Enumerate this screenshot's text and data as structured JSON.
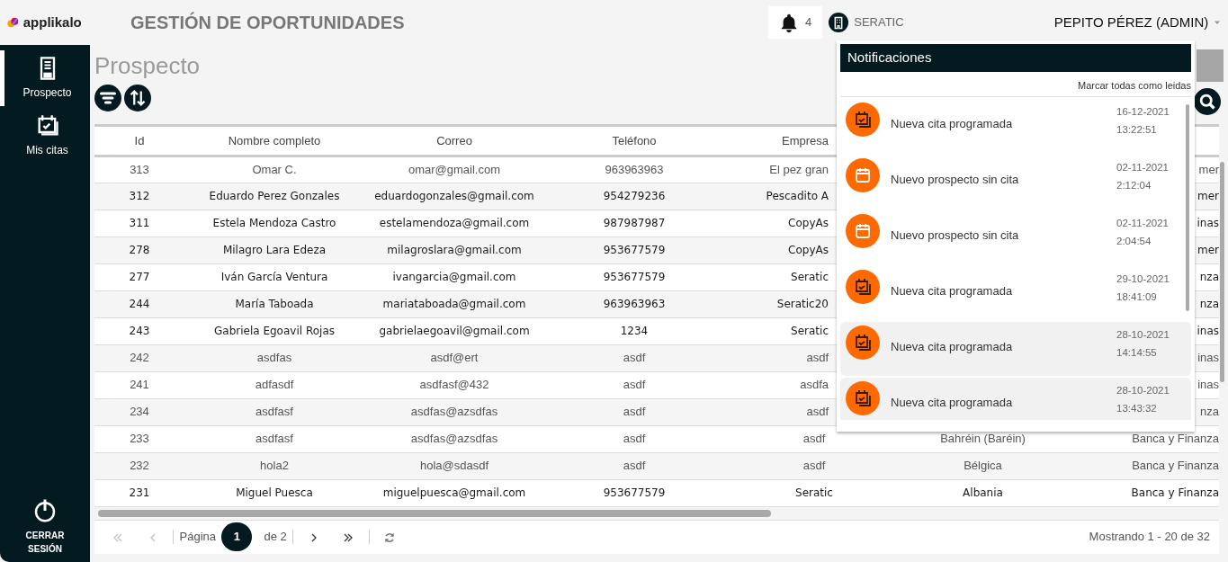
{
  "header": {
    "logo_text": "applikalo",
    "title": "GESTIÓN DE OPORTUNIDADES",
    "notification_count": "4",
    "company": "SERATIC",
    "user": "PEPITO PÉREZ (ADMIN)"
  },
  "sidebar": {
    "items": [
      {
        "kind": "document",
        "label": "Prospecto",
        "selected": true
      },
      {
        "kind": "calendar",
        "label": "Mis citas",
        "selected": false
      }
    ],
    "logout": "CERRAR SESIÓN"
  },
  "page_title": "Prospecto",
  "table": {
    "columns": [
      "Id",
      "Nombre completo",
      "Correo",
      "Teléfono",
      "Empresa"
    ],
    "rows": [
      {
        "id": "313",
        "name": "Omar C.",
        "email": "omar@gmail.com",
        "phone": "963963963",
        "company": "El pez gran",
        "column_7": "mer",
        "emphasis": false
      },
      {
        "id": "312",
        "name": "Eduardo Perez Gonzales",
        "email": "eduardogonzales@gmail.com",
        "phone": "954279236",
        "company": "Pescadito A",
        "column_7": "mer",
        "emphasis": true
      },
      {
        "id": "311",
        "name": "Estela Mendoza Castro",
        "email": "estelamendoza@gmail.com",
        "phone": "987987987",
        "company": "CopyAs",
        "column_7": "inas",
        "emphasis": true
      },
      {
        "id": "278",
        "name": "Milagro Lara Edeza",
        "email": "milagroslara@gmail.com",
        "phone": "953677579",
        "company": "CopyAs",
        "column_7": "mer",
        "emphasis": true
      },
      {
        "id": "277",
        "name": "Iván García Ventura",
        "email": "ivangarcia@gmail.com",
        "phone": "953677579",
        "company": "Seratic",
        "column_7": "nza",
        "emphasis": true
      },
      {
        "id": "244",
        "name": "María Taboada",
        "email": "mariataboada@gmail.com",
        "phone": "963963963",
        "company": "Seratic20",
        "column_7": "nza",
        "emphasis": true
      },
      {
        "id": "243",
        "name": "Gabriela Egoavil Rojas",
        "email": "gabrielaegoavil@gmail.com",
        "phone": "1234",
        "company": "Seratic",
        "column_7": "inas",
        "emphasis": true
      },
      {
        "id": "242",
        "name": "asdfas",
        "email": "asdf@ert",
        "phone": "asdf",
        "company": "asdf",
        "column_7": "inas",
        "emphasis": false
      },
      {
        "id": "241",
        "name": "adfasdf",
        "email": "asdfasf@432",
        "phone": "asdf",
        "company": "asdfa",
        "column_7": "inas",
        "emphasis": false
      },
      {
        "id": "234",
        "name": "asdfasf",
        "email": "asdfas@azsdfas",
        "phone": "asdf",
        "company": "asdf",
        "column_7": "nza",
        "emphasis": false
      },
      {
        "id": "233",
        "name": "asdfasf",
        "email": "asdfas@azsdfas",
        "phone": "asdf",
        "company": "asdf",
        "column_6": "Bahréin (Baréin)",
        "column_7": "Banca y Finanza",
        "emphasis": false
      },
      {
        "id": "232",
        "name": "hola2",
        "email": "hola@sdasdf",
        "phone": "asdf",
        "company": "asdf",
        "column_6": "Bélgica",
        "column_7": "Banca y Finanza",
        "emphasis": false
      },
      {
        "id": "231",
        "name": "Miguel Puesca",
        "email": "miguelpuesca@gmail.com",
        "phone": "953677579",
        "company": "Seratic",
        "column_6": "Albania",
        "column_7": "Banca y Finanza",
        "emphasis": true
      }
    ]
  },
  "pagination": {
    "buttons": [
      {
        "kind": "first",
        "disabled": true
      },
      {
        "kind": "prev",
        "disabled": true
      },
      {
        "kind": "next",
        "disabled": false
      },
      {
        "kind": "last",
        "disabled": false
      }
    ],
    "page_label": "Página",
    "current_page": "1",
    "of_label": "de 2",
    "summary": "Mostrando 1 - 20 de 32"
  },
  "notifications": {
    "title": "Notificaciones",
    "mark_all": "Marcar todas como leidas",
    "items": [
      {
        "kind": "appointment",
        "title": "Nueva cita programada",
        "date": "16-12-2021",
        "time": "13:22:51",
        "highlighted": false
      },
      {
        "kind": "prospect",
        "title": "Nuevo prospecto sin cita",
        "date": "02-11-2021",
        "time": "2:12:04",
        "highlighted": false
      },
      {
        "kind": "prospect",
        "title": "Nuevo prospecto sin cita",
        "date": "02-11-2021",
        "time": "2:04:54",
        "highlighted": false
      },
      {
        "kind": "appointment",
        "title": "Nueva cita programada",
        "date": "29-10-2021",
        "time": "18:41:09",
        "highlighted": false
      },
      {
        "kind": "appointment",
        "title": "Nueva cita programada",
        "date": "28-10-2021",
        "time": "14:14:55",
        "highlighted": true
      },
      {
        "kind": "appointment",
        "title": "Nueva cita programada",
        "date": "28-10-2021",
        "time": "13:43:32",
        "highlighted": true
      }
    ]
  }
}
